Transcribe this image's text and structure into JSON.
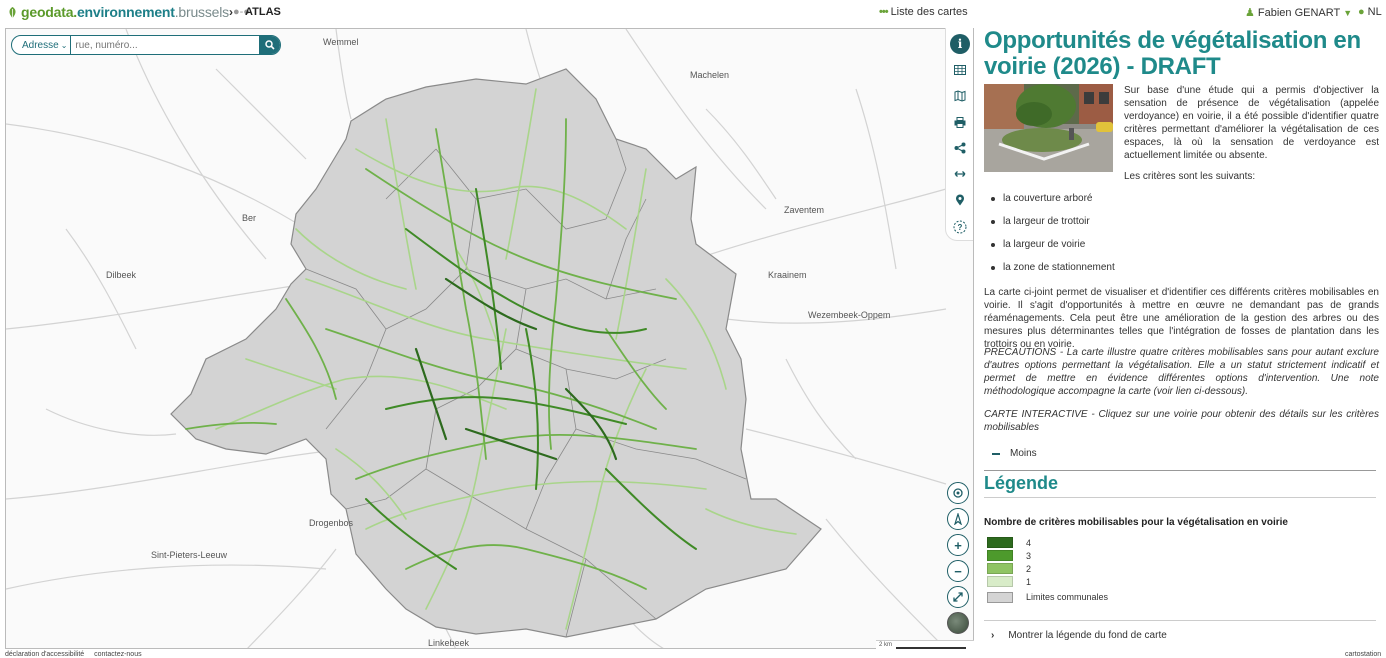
{
  "header": {
    "brand_part1": "geodata.",
    "brand_part2": "environnement",
    "brand_part3": ".brussels",
    "breadcrumb": "ATLAS",
    "map_list_label": "Liste des cartes",
    "user_name": "Fabien GENART",
    "lang_label": "NL"
  },
  "search": {
    "type_label": "Adresse",
    "placeholder": "rue, numéro..."
  },
  "map": {
    "places": [
      "Wemmel",
      "Machelen",
      "Zaventem",
      "Kraainem",
      "Wezembeek-Oppem",
      "Dilbeek",
      "Drogenbos",
      "Sint-Pieters-Leeuw",
      "Linkebeek",
      "Ber"
    ],
    "scale_label": "2 km"
  },
  "footer": {
    "accessibility": "déclaration d'accessibilité",
    "contact": "contactez-nous",
    "credit": "cartostation"
  },
  "panel": {
    "title": "Opportunités de végétalisation en voirie (2026) - DRAFT",
    "intro": "Sur base d'une étude qui a permis d'objectiver la sensation de présence de végétalisation (appelée verdoyance) en voirie, il a été possible d'identifier quatre critères permettant d'améliorer la végétalisation de ces espaces, là où la sensation de verdoyance est actuellement limitée ou absente.",
    "criteria_intro": "Les critères sont les suivants:",
    "criteria": [
      "la couverture arboré",
      "la largeur de trottoir",
      "la largeur de voirie",
      "la zone de stationnement"
    ],
    "paragraph1": "La carte ci-joint permet de visualiser et d'identifier ces différents critères mobilisables en voirie. Il s'agit d'opportunités à mettre en œuvre ne demandant pas de grands réaménagements. Cela peut être une amélioration de la gestion des arbres ou des mesures plus déterminantes telles que l'intégration de fosses de plantation dans les trottoirs ou en voirie.",
    "precautions": "PRECAUTIONS - La carte illustre quatre critères mobilisables sans pour autant exclure d'autres options permettant la végétalisation. Elle a un statut strictement indicatif et permet de mettre en évidence différentes options d'intervention. Une note méthodologique accompagne la carte (voir lien ci-dessous).",
    "interactive": "CARTE INTERACTIVE - Cliquez sur une voirie pour obtenir des détails sur les critères mobilisables",
    "less_label": "Moins"
  },
  "legend": {
    "title": "Légende",
    "subtitle": "Nombre de critères mobilisables pour la végétalisation en voirie",
    "items": [
      {
        "label": "4",
        "color": "#2d6a1e"
      },
      {
        "label": "3",
        "color": "#4d9a2c"
      },
      {
        "label": "2",
        "color": "#8fc463"
      },
      {
        "label": "1",
        "color": "#d8ecc8"
      }
    ],
    "boundary_label": "Limites communales",
    "boundary_color": "#d4d4d4",
    "show_base_legend": "Montrer la légende du fond de carte"
  },
  "colors": {
    "accent": "#1f8a8a",
    "dark_teal": "#1f5e66",
    "brand_green": "#6aa339"
  }
}
